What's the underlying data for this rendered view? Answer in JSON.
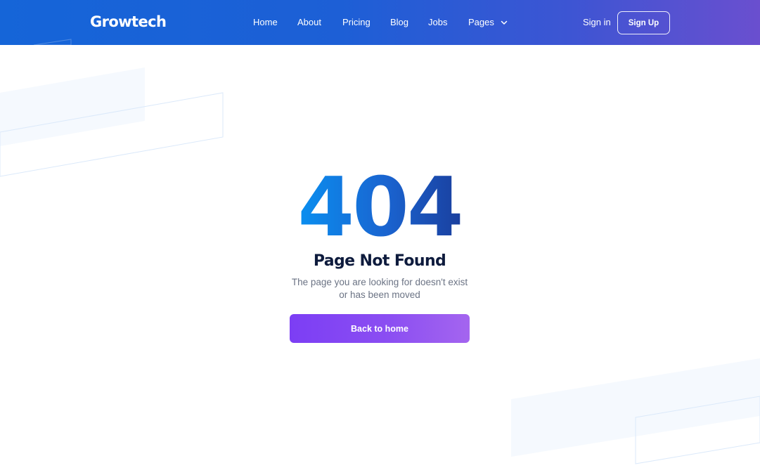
{
  "header": {
    "logo": "Growtech",
    "nav": [
      {
        "label": "Home"
      },
      {
        "label": "About"
      },
      {
        "label": "Pricing"
      },
      {
        "label": "Blog"
      },
      {
        "label": "Jobs"
      },
      {
        "label": "Pages",
        "icon": "chevron-down-icon"
      }
    ],
    "sign_in": "Sign in",
    "sign_up": "Sign Up"
  },
  "main": {
    "error_code": "404",
    "title": "Page Not Found",
    "description_line1": "The page you are looking for doesn't exist",
    "description_line2": "or has been moved",
    "button_label": "Back to home"
  },
  "colors": {
    "header_gradient_start": "#1565d8",
    "header_gradient_end": "#6a4fcf",
    "code_gradient_start": "#0a8ff0",
    "code_gradient_end": "#1a3f9e",
    "button_gradient_start": "#7c3ef4",
    "button_gradient_end": "#a465ef",
    "title": "#0e1b3d",
    "description": "#6b7384"
  }
}
